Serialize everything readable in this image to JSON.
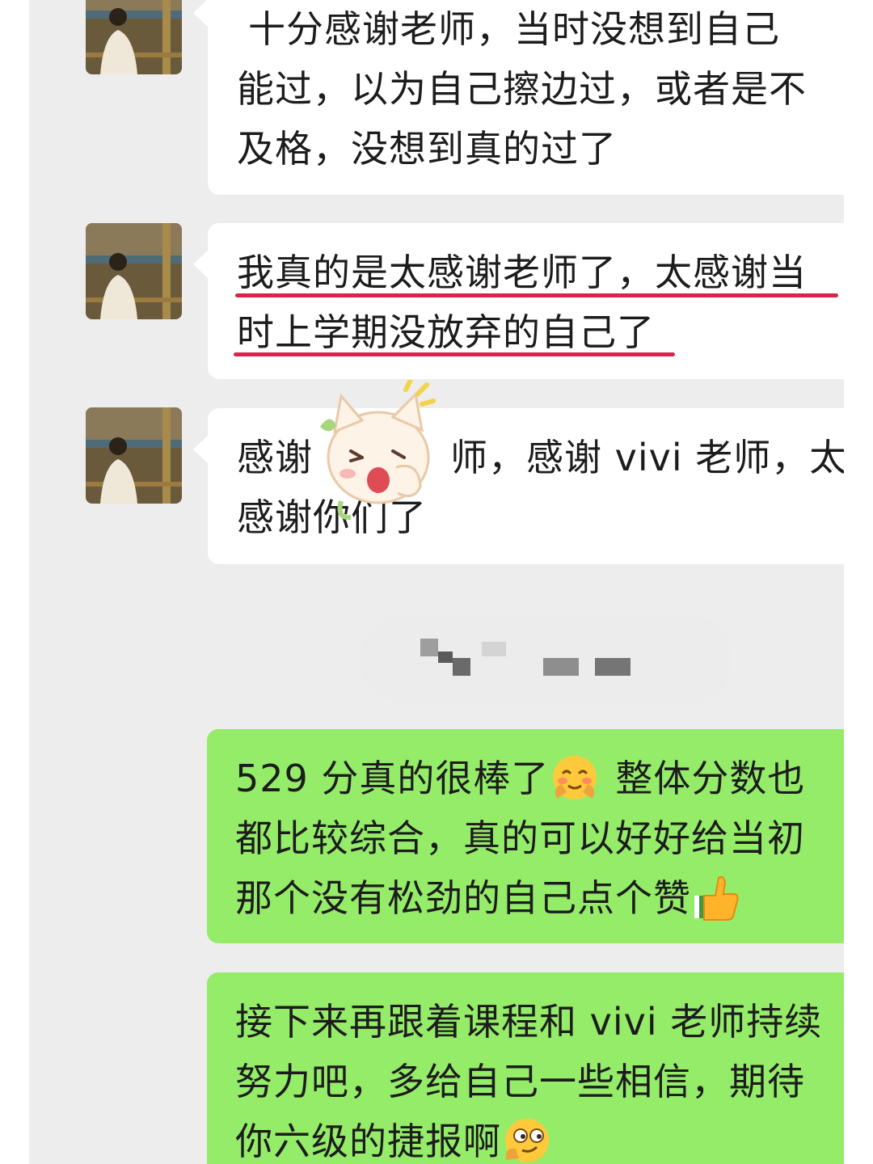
{
  "conversation": {
    "messages": [
      {
        "direction": "incoming",
        "lines": [
          "十分感谢老师，当时没想到自己",
          "能过，以为自己擦边过，或者是不",
          "及格，没想到真的过了"
        ]
      },
      {
        "direction": "incoming",
        "lines": [
          "我真的是太感谢老师了，太感谢当",
          "时上学期没放弃的自己了"
        ],
        "underline_color": "#d8234a"
      },
      {
        "direction": "incoming",
        "lines": [
          "感谢",
          "师，感谢 vivi 老师，太",
          "感谢你们了"
        ]
      },
      {
        "direction": "outgoing",
        "lines": [
          "529 分真的很棒了",
          "整体分数也",
          "都比较综合，真的可以好好给当初",
          "那个没有松劲的自己点个赞"
        ]
      },
      {
        "direction": "outgoing",
        "lines": [
          "接下来再跟着课程和 vivi 老师持续",
          "努力吧，多给自己一些相信，期待",
          "你六级的捷报啊"
        ]
      }
    ]
  },
  "colors": {
    "chat_background": "#ededed",
    "incoming_bubble": "#ffffff",
    "outgoing_bubble": "#95ec69",
    "text": "#1c1c1c",
    "highlight_underline": "#d8234a"
  },
  "icons": {
    "sender_avatar": "person-photo",
    "sticker": "crying-cat-sticker",
    "emoji_1": "shy-face-emoji",
    "emoji_2": "thumbs-up-emoji",
    "emoji_3": "smirk-face-emoji"
  }
}
